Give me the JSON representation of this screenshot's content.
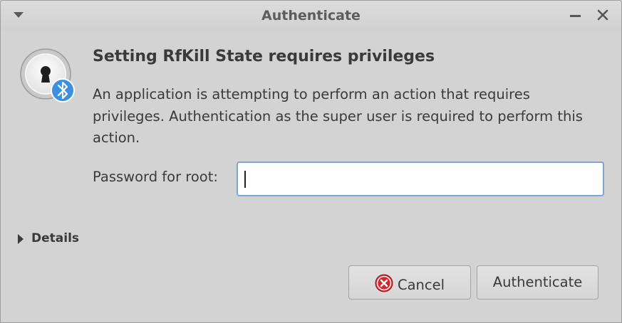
{
  "window": {
    "title": "Authenticate"
  },
  "dialog": {
    "heading": "Setting RfKill State requires privileges",
    "description": "An application is attempting to perform an action that requires privileges. Authentication as the super user is required to perform this action.",
    "password_label": "Password for root:",
    "password_value": "",
    "details_label": "Details"
  },
  "buttons": {
    "cancel_label": "Cancel",
    "authenticate_label": "Authenticate"
  },
  "icons": {
    "window_menu": "chevron-down-icon",
    "minimize": "minimize-icon",
    "close": "close-icon",
    "dialog_icon": "lock-icon",
    "badge": "bluetooth-icon",
    "details_toggle": "triangle-right-icon",
    "cancel": "cancel-icon"
  },
  "colors": {
    "focus_border": "#7fa6d2",
    "bluetooth_badge": "#3d8fe0",
    "cancel_icon": "#d8252b"
  }
}
